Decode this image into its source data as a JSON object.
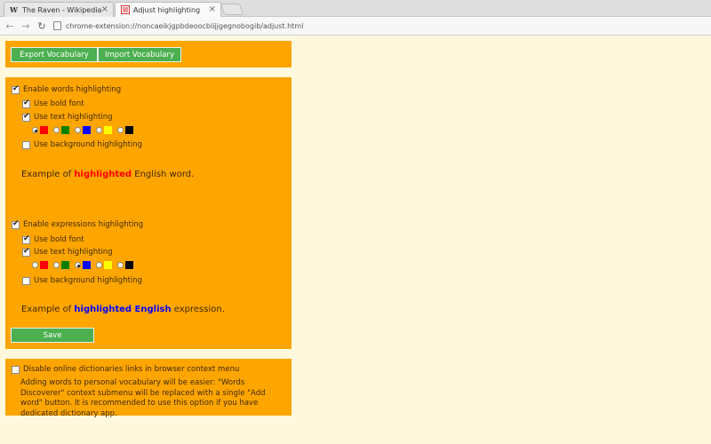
{
  "browser": {
    "tabs": [
      {
        "title": "The Raven - Wikipedia",
        "favicon": "W",
        "active": false
      },
      {
        "title": "Adjust highlighting",
        "active": true
      }
    ],
    "url": "chrome-extension://noncaeikjgpbdeoocblijjgegnobogib/adjust.html"
  },
  "vocabulary": {
    "export_label": "Export Vocabulary",
    "import_label": "Import Vocabulary"
  },
  "words": {
    "enable_label": "Enable words highlighting",
    "enable_checked": true,
    "bold_label": "Use bold font",
    "bold_checked": true,
    "text_label": "Use text highlighting",
    "text_checked": true,
    "background_label": "Use background highlighting",
    "background_checked": false,
    "colors": [
      "#ff0000",
      "#008000",
      "#0000ff",
      "#ffff00",
      "#000000"
    ],
    "selected_color_index": 0,
    "example_prefix": "Example of ",
    "example_highlight": "highlighted",
    "example_suffix": " English word."
  },
  "expressions": {
    "enable_label": "Enable expressions highlighting",
    "enable_checked": true,
    "bold_label": "Use bold font",
    "bold_checked": true,
    "text_label": "Use text highlighting",
    "text_checked": true,
    "background_label": "Use background highlighting",
    "background_checked": false,
    "colors": [
      "#ff0000",
      "#008000",
      "#0000ff",
      "#ffff00",
      "#000000"
    ],
    "selected_color_index": 2,
    "example_prefix": "Example of ",
    "example_highlight": "highlighted English",
    "example_suffix": " expression."
  },
  "save_label": "Save",
  "dictionaries": {
    "label": "Disable online dictionaries links in browser context menu",
    "checked": false,
    "description": "Adding words to personal vocabulary will be easier: \"Words Discoverer\" context submenu will be replaced with a single \"Add word\" button. It is recommended to use this option if you have dedicated dictionary app."
  },
  "colors": {
    "panel": "#ffa500",
    "page_background": "#fff8dc",
    "button": "#4caf50"
  }
}
